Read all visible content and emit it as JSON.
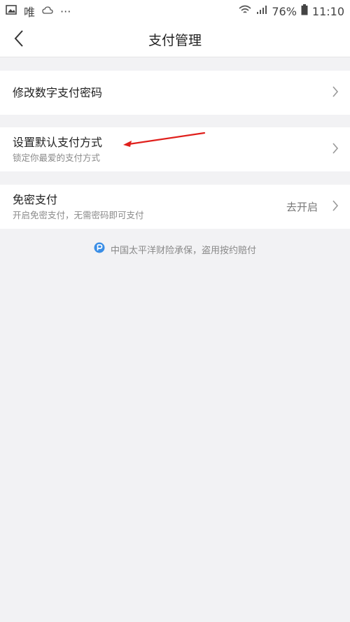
{
  "status_bar": {
    "left_glyph": "唯",
    "more_dots": "···",
    "battery": "76%",
    "time": "11:10"
  },
  "nav": {
    "title": "支付管理"
  },
  "items": [
    {
      "title": "修改数字支付密码"
    },
    {
      "title": "设置默认支付方式",
      "subtitle": "锁定你最爱的支付方式"
    },
    {
      "title": "免密支付",
      "subtitle": "开启免密支付，无需密码即可支付",
      "value": "去开启"
    }
  ],
  "footer": {
    "text": "中国太平洋财险承保，盗用按约赔付"
  },
  "colors": {
    "page_bg": "#f2f2f4",
    "card_bg": "#ffffff",
    "accent_blue": "#3a8ee6",
    "annotation_red": "#e0201c"
  }
}
